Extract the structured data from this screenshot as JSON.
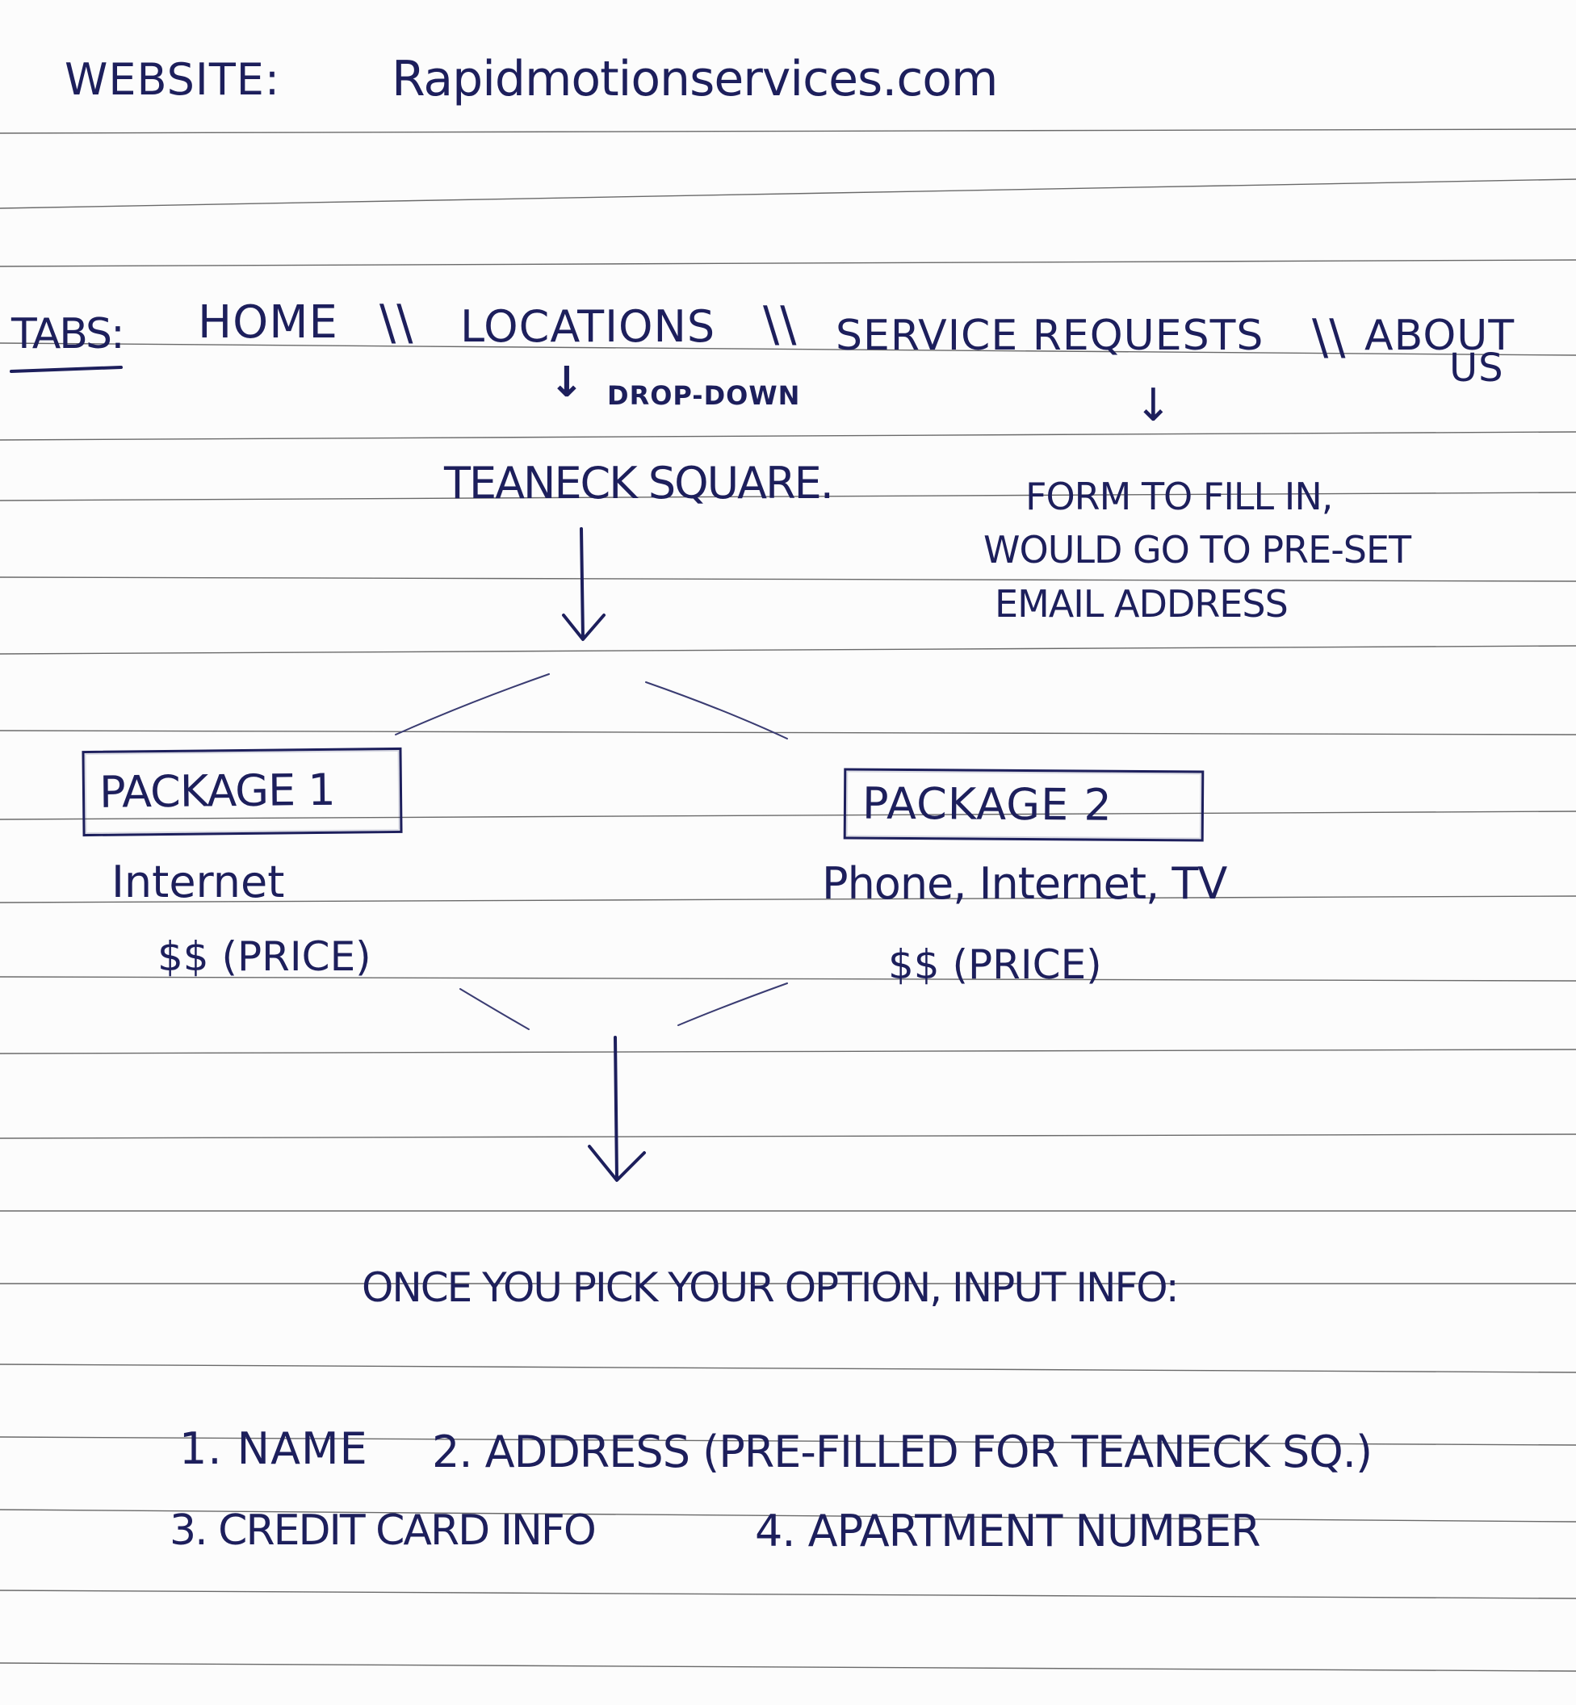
{
  "website": {
    "label": "WEBSITE:",
    "domain": "Rapidmotionservices.com"
  },
  "tabs": {
    "label": "TABS:",
    "items": [
      {
        "label": "HOME"
      },
      {
        "label": "LOCATIONS"
      },
      {
        "label": "SERVICE REQUESTS"
      },
      {
        "label": "ABOUT",
        "label_line2": "US"
      }
    ],
    "separator": "\\\\"
  },
  "locations_branch": {
    "arrow": "↓",
    "note": "DROP-DOWN",
    "location": "TEANECK SQUARE."
  },
  "service_requests_branch": {
    "arrow": "↓",
    "lines": [
      "FORM TO FILL IN,",
      "WOULD GO TO PRE-SET",
      "EMAIL ADDRESS"
    ]
  },
  "packages": [
    {
      "title": "PACKAGE 1",
      "services": "Internet",
      "price": "$$ (PRICE)"
    },
    {
      "title": "PACKAGE 2",
      "services": "Phone, Internet, TV",
      "price": "$$ (PRICE)"
    }
  ],
  "checkout": {
    "heading": "ONCE YOU PICK YOUR OPTION, INPUT INFO:",
    "fields": [
      {
        "label": "1. NAME"
      },
      {
        "label": "2. ADDRESS (PRE-FILLED FOR TEANECK SQ.)"
      },
      {
        "label": "3. CREDIT CARD INFO"
      },
      {
        "label": "4. APARTMENT NUMBER"
      }
    ]
  },
  "colors": {
    "ink": "#1d1f5c",
    "paper": "#fcfcfc",
    "rule_line": "#5a5a5a"
  }
}
